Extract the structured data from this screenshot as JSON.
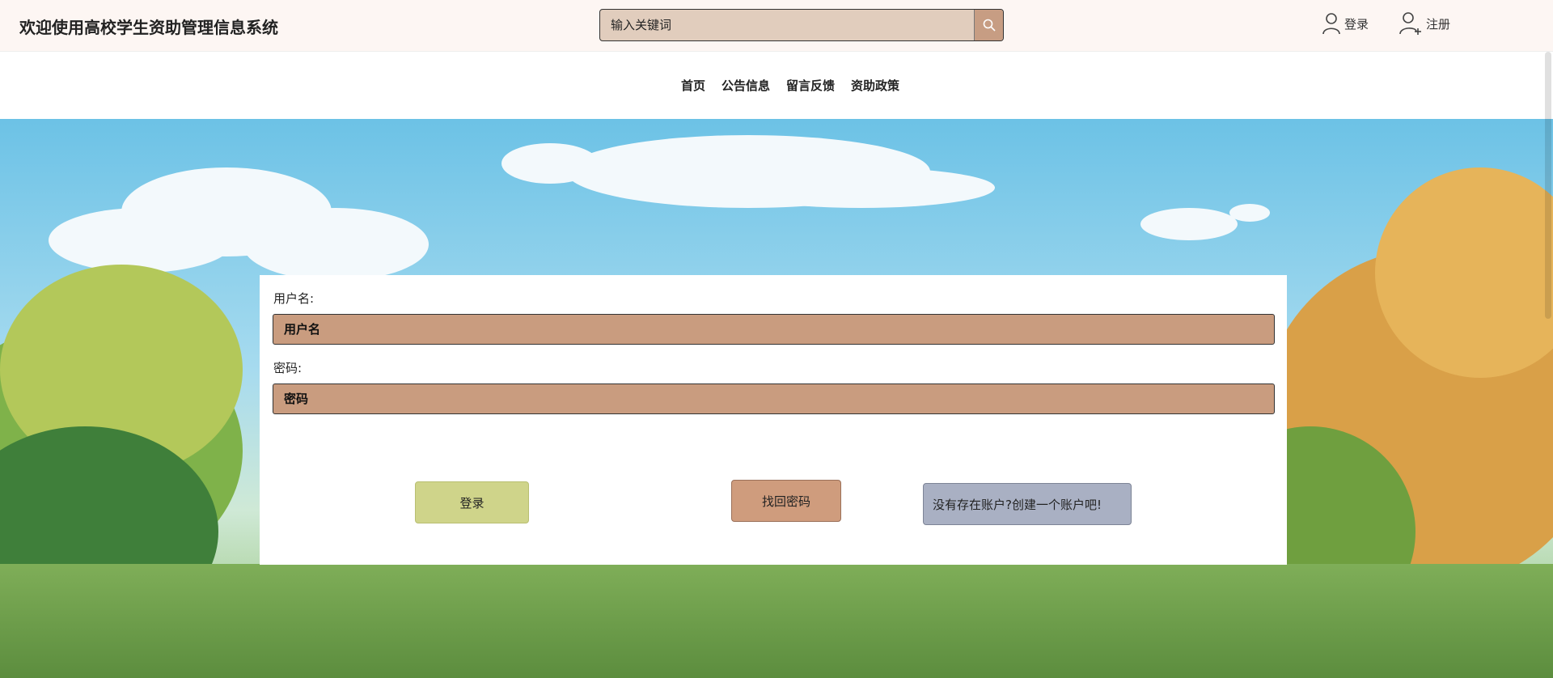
{
  "header": {
    "title": "欢迎使用高校学生资助管理信息系统",
    "search_placeholder": "输入关键词",
    "search_icon": "search-icon",
    "login_label": "登录",
    "register_label": "注册",
    "login_icon": "user-icon",
    "register_icon": "user-add-icon"
  },
  "nav": {
    "items": [
      {
        "label": "首页"
      },
      {
        "label": "公告信息"
      },
      {
        "label": "留言反馈"
      },
      {
        "label": "资助政策"
      }
    ]
  },
  "login_form": {
    "username_label": "用户名:",
    "username_placeholder": "用户名",
    "password_label": "密码:",
    "password_placeholder": "密码",
    "login_button": "登录",
    "forgot_button": "找回密码",
    "register_button": "没有存在账户?创建一个账户吧!"
  },
  "colors": {
    "search_bg": "#e1cdbd",
    "input_bg": "#c99c7f",
    "login_btn": "#cfd48a",
    "forgot_btn": "#cf9c7d",
    "register_btn": "#a9b0c3"
  }
}
